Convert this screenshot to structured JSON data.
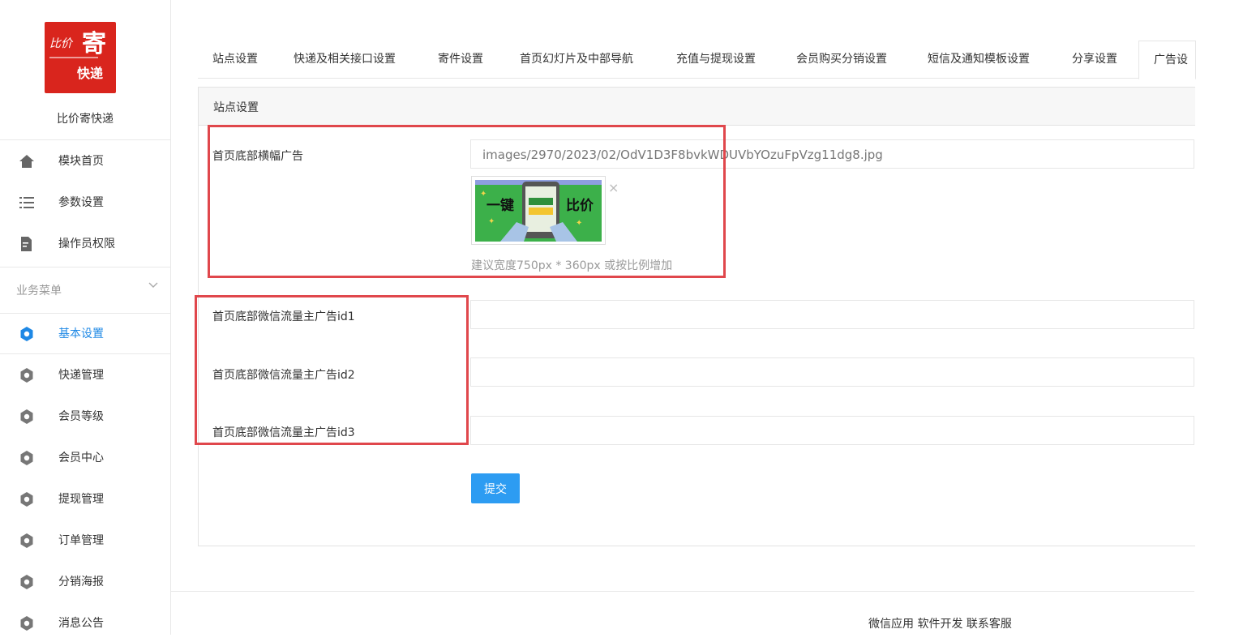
{
  "brand": {
    "logo_line1": "比价",
    "logo_big": "寄",
    "logo_line2": "快递",
    "name": "比价寄快递"
  },
  "sidebar": {
    "top_items": [
      {
        "label": "模块首页",
        "icon": "home-icon"
      },
      {
        "label": "参数设置",
        "icon": "list-icon"
      },
      {
        "label": "操作员权限",
        "icon": "document-edit-icon"
      }
    ],
    "group_label": "业务菜单",
    "menu_items": [
      {
        "label": "基本设置",
        "icon": "gear-icon",
        "active": true
      },
      {
        "label": "快递管理",
        "icon": "gear-icon"
      },
      {
        "label": "会员等级",
        "icon": "gear-icon"
      },
      {
        "label": "会员中心",
        "icon": "gear-icon"
      },
      {
        "label": "提现管理",
        "icon": "gear-icon"
      },
      {
        "label": "订单管理",
        "icon": "gear-icon"
      },
      {
        "label": "分销海报",
        "icon": "gear-icon"
      },
      {
        "label": "消息公告",
        "icon": "gear-icon"
      }
    ]
  },
  "tabs": [
    {
      "label": "站点设置"
    },
    {
      "label": "快递及相关接口设置"
    },
    {
      "label": "寄件设置"
    },
    {
      "label": "首页幻灯片及中部导航"
    },
    {
      "label": "充值与提现设置"
    },
    {
      "label": "会员购买分销设置"
    },
    {
      "label": "短信及通知模板设置"
    },
    {
      "label": "分享设置"
    },
    {
      "label": "广告设",
      "active": true
    }
  ],
  "panel": {
    "title": "站点设置",
    "banner": {
      "label": "首页底部横幅广告",
      "value": "images/2970/2023/02/OdV1D3F8bvkWDUVbYOzuFpVzg11dg8.jpg",
      "thumb_text_left": "一键",
      "thumb_text_right": "比价",
      "hint": "建议宽度750px * 360px 或按比例增加"
    },
    "fields": [
      {
        "label": "首页底部微信流量主广告id1",
        "value": ""
      },
      {
        "label": "首页底部微信流量主广告id2",
        "value": ""
      },
      {
        "label": "首页底部微信流量主广告id3",
        "value": ""
      }
    ],
    "submit_label": "提交"
  },
  "footer": {
    "text": "微信应用 软件开发 联系客服"
  },
  "colors": {
    "accent": "#2d9cf2",
    "highlight": "#e0474c",
    "brand": "#d9251d"
  }
}
